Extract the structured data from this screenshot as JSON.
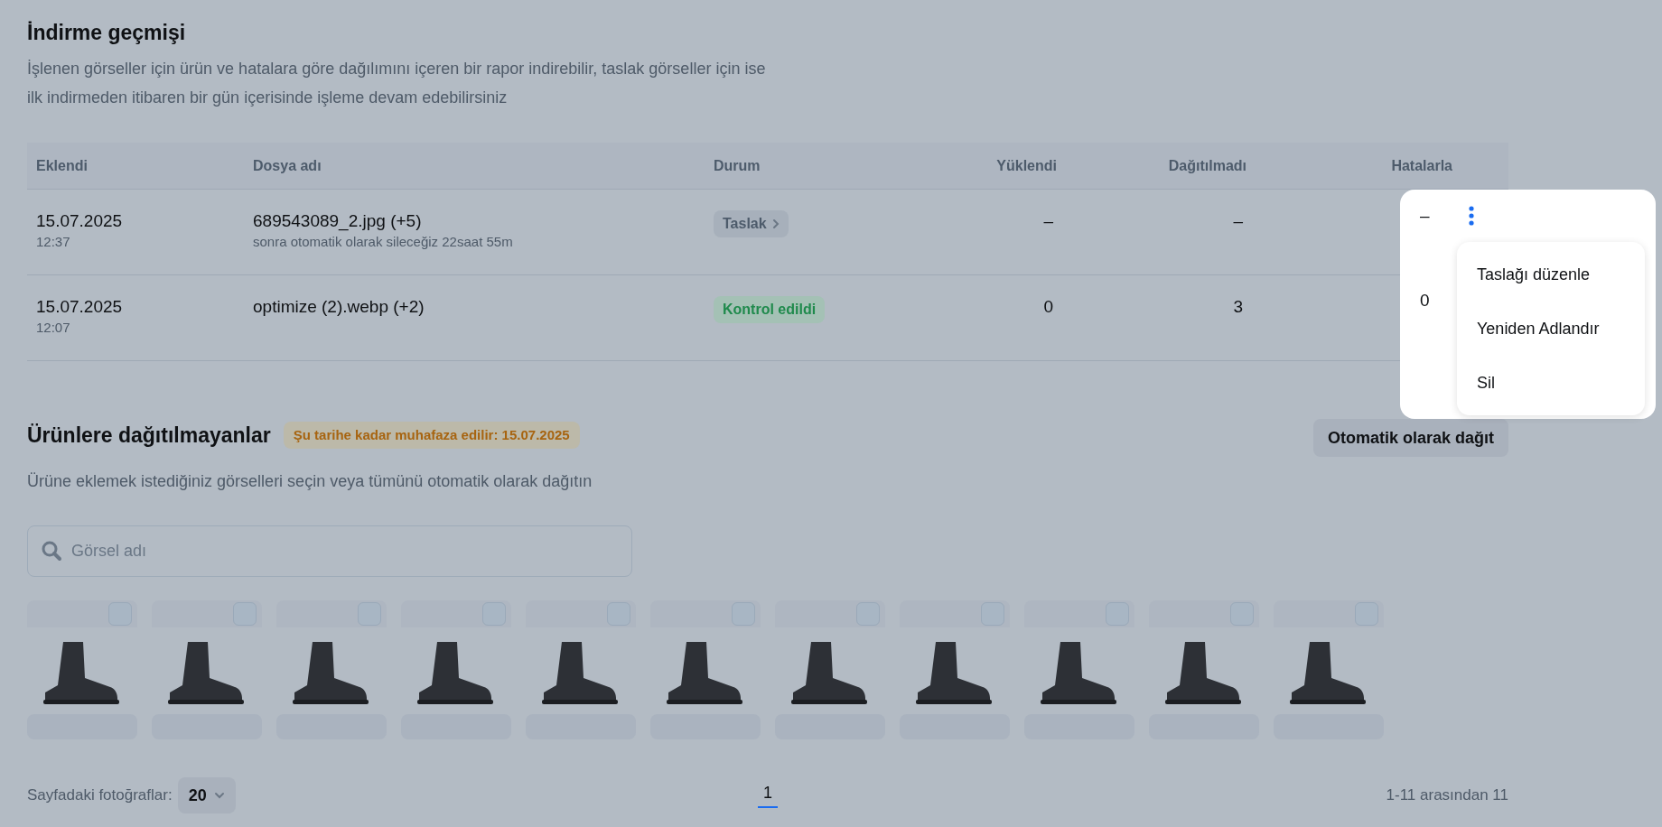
{
  "history": {
    "title": "İndirme geçmişi",
    "description_lines": [
      "İşlenen görseller için ürün ve hatalara göre dağılımını içeren bir rapor indirebilir, taslak görseller için ise",
      "ilk indirmeden itibaren bir gün içerisinde işleme devam edebilirsiniz"
    ],
    "columns": [
      "Eklendi",
      "Dosya adı",
      "Durum",
      "Yüklendi",
      "Dağıtılmadı",
      "Hatalarla"
    ],
    "rows": [
      {
        "date": "15.07.2025",
        "time": "12:37",
        "file": "689543089_2.jpg (+5)",
        "note": "sonra otomatik olarak sileceğiz 22saat 55m",
        "status": {
          "kind": "draft",
          "label": "Taslak"
        },
        "uploaded": "–",
        "unassigned": "–",
        "errors": "–",
        "menu_open": true
      },
      {
        "date": "15.07.2025",
        "time": "12:07",
        "file": "optimize (2).webp (+2)",
        "status": {
          "kind": "checked",
          "label": "Kontrol edildi"
        },
        "uploaded": "0",
        "unassigned": "3",
        "errors": "0",
        "menu_open": false
      }
    ]
  },
  "row_menu": {
    "items": [
      "Taslağı düzenle",
      "Yeniden Adlandır",
      "Sil"
    ]
  },
  "unassigned": {
    "title": "Ürünlere dağıtılmayanlar",
    "retention_badge": "Şu tarihe kadar muhafaza edilir: 15.07.2025",
    "auto_button": "Otomatik olarak dağıt",
    "description": "Ürüne eklemek istediğiniz görselleri seçin veya tümünü otomatik olarak dağıtın",
    "search": {
      "placeholder": "Görsel adı"
    },
    "images": [
      {
        "checked": false
      },
      {
        "checked": false
      },
      {
        "checked": false
      },
      {
        "checked": false
      },
      {
        "checked": false
      },
      {
        "checked": false
      },
      {
        "checked": false
      },
      {
        "checked": false
      },
      {
        "checked": false
      },
      {
        "checked": false
      },
      {
        "checked": false
      }
    ]
  },
  "footer": {
    "per_page_label": "Sayfadaki fotoğraflar:",
    "per_page": "20",
    "pages": [
      {
        "label": "1",
        "selected": true
      }
    ],
    "range": "1-11 arasından 11"
  }
}
